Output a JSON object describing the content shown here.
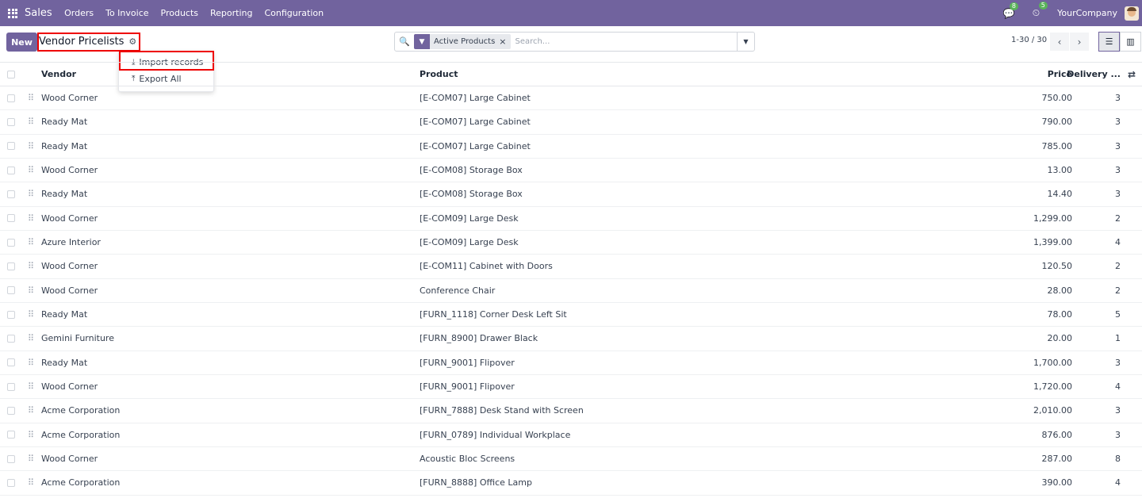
{
  "navbar": {
    "app_name": "Sales",
    "menu": [
      "Orders",
      "To Invoice",
      "Products",
      "Reporting",
      "Configuration"
    ],
    "messages_count": "8",
    "activities_count": "5",
    "company": "YourCompany",
    "icons": {
      "apps": "apps-grid-icon",
      "messages": "chat-icon",
      "activities": "clock-icon"
    }
  },
  "control_panel": {
    "new_label": "New",
    "title": "Vendor Pricelists",
    "actions_menu": {
      "import_label": "Import records",
      "export_label": "Export All"
    },
    "search": {
      "facet_label": "Active Products",
      "placeholder": "Search..."
    },
    "pager": "1-30 / 30"
  },
  "table": {
    "columns": {
      "vendor": "Vendor",
      "product": "Product",
      "price": "Price",
      "delivery": "Delivery ..."
    },
    "rows": [
      {
        "vendor": "Wood Corner",
        "product": "[E-COM07] Large Cabinet",
        "price": "750.00",
        "delivery": "3"
      },
      {
        "vendor": "Ready Mat",
        "product": "[E-COM07] Large Cabinet",
        "price": "790.00",
        "delivery": "3"
      },
      {
        "vendor": "Ready Mat",
        "product": "[E-COM07] Large Cabinet",
        "price": "785.00",
        "delivery": "3"
      },
      {
        "vendor": "Wood Corner",
        "product": "[E-COM08] Storage Box",
        "price": "13.00",
        "delivery": "3"
      },
      {
        "vendor": "Ready Mat",
        "product": "[E-COM08] Storage Box",
        "price": "14.40",
        "delivery": "3"
      },
      {
        "vendor": "Wood Corner",
        "product": "[E-COM09] Large Desk",
        "price": "1,299.00",
        "delivery": "2"
      },
      {
        "vendor": "Azure Interior",
        "product": "[E-COM09] Large Desk",
        "price": "1,399.00",
        "delivery": "4"
      },
      {
        "vendor": "Wood Corner",
        "product": "[E-COM11] Cabinet with Doors",
        "price": "120.50",
        "delivery": "2"
      },
      {
        "vendor": "Wood Corner",
        "product": "Conference Chair",
        "price": "28.00",
        "delivery": "2"
      },
      {
        "vendor": "Ready Mat",
        "product": "[FURN_1118] Corner Desk Left Sit",
        "price": "78.00",
        "delivery": "5"
      },
      {
        "vendor": "Gemini Furniture",
        "product": "[FURN_8900] Drawer Black",
        "price": "20.00",
        "delivery": "1"
      },
      {
        "vendor": "Ready Mat",
        "product": "[FURN_9001] Flipover",
        "price": "1,700.00",
        "delivery": "3"
      },
      {
        "vendor": "Wood Corner",
        "product": "[FURN_9001] Flipover",
        "price": "1,720.00",
        "delivery": "4"
      },
      {
        "vendor": "Acme Corporation",
        "product": "[FURN_7888] Desk Stand with Screen",
        "price": "2,010.00",
        "delivery": "3"
      },
      {
        "vendor": "Acme Corporation",
        "product": "[FURN_0789] Individual Workplace",
        "price": "876.00",
        "delivery": "3"
      },
      {
        "vendor": "Wood Corner",
        "product": "Acoustic Bloc Screens",
        "price": "287.00",
        "delivery": "8"
      },
      {
        "vendor": "Acme Corporation",
        "product": "[FURN_8888] Office Lamp",
        "price": "390.00",
        "delivery": "4"
      }
    ]
  },
  "colors": {
    "brand": "#71639e",
    "highlight": "#ee0000",
    "badge": "#5ab35a"
  }
}
